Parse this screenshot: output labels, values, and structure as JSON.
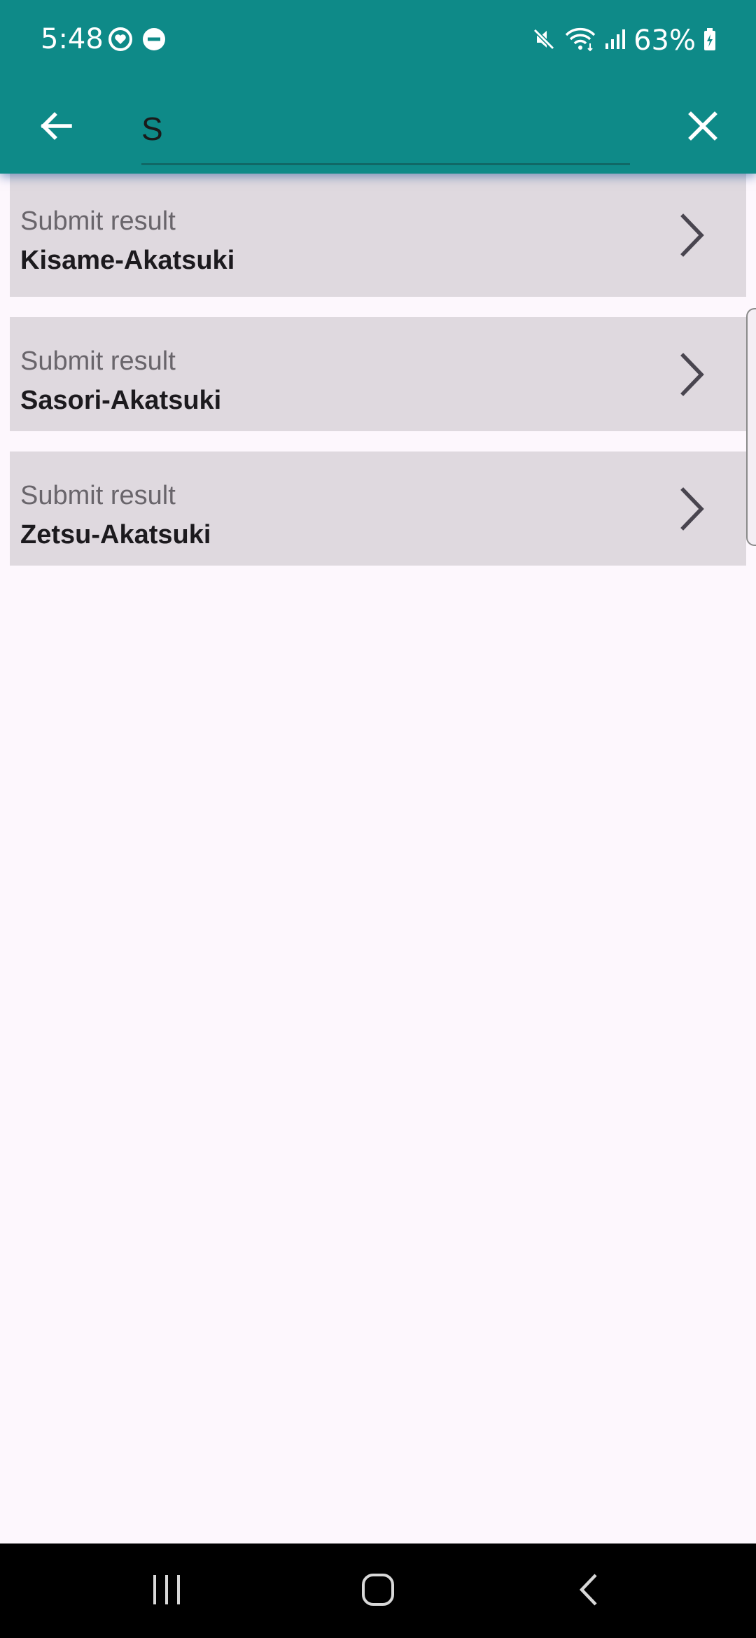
{
  "status_bar": {
    "time": "5:48",
    "battery": "63%",
    "icons": [
      "heart-monitor-icon",
      "dnd-icon",
      "mute-icon",
      "wifi-icon",
      "signal-icon",
      "battery-charging-icon"
    ]
  },
  "search": {
    "query": "S",
    "back_icon": "arrow-left-icon",
    "clear_icon": "close-icon"
  },
  "results": [
    {
      "subtitle": "Submit result",
      "title": "Kisame-Akatsuki"
    },
    {
      "subtitle": "Submit result",
      "title": "Sasori-Akatsuki"
    },
    {
      "subtitle": "Submit result",
      "title": "Zetsu-Akatsuki"
    }
  ],
  "nav_bar": {
    "icons": [
      "recent-apps-icon",
      "home-icon",
      "back-icon"
    ]
  },
  "colors": {
    "app_bar": "#0e8a88",
    "background": "#fdf7fd",
    "result_card": "#dfd9df"
  }
}
